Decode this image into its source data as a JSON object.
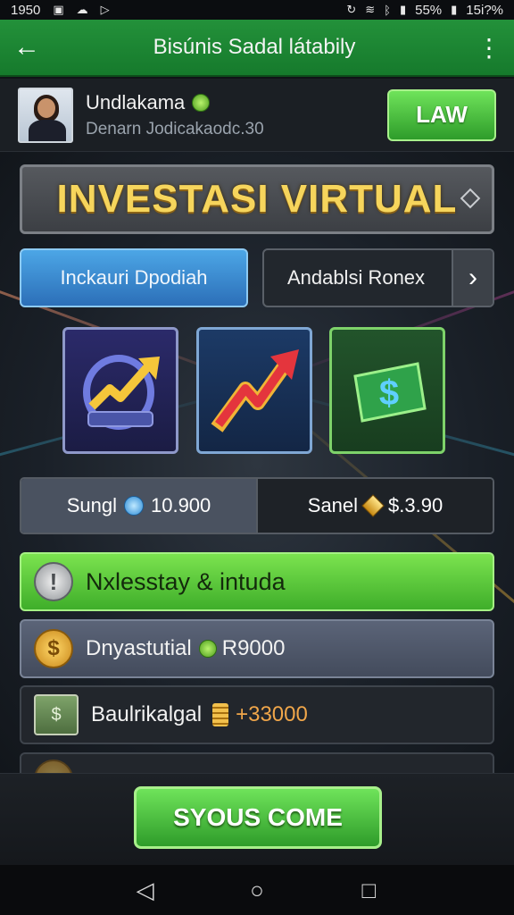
{
  "status_bar": {
    "time": "1950",
    "battery": "55%",
    "extra": "15i?%"
  },
  "app_bar": {
    "title": "Bisúnis Sadal látabily"
  },
  "profile": {
    "name": "Undlakama",
    "subtitle": "Denarn Jodicakaodc.30",
    "action_label": "LAW"
  },
  "banner": {
    "title": "INVESTASI VIRTUAL"
  },
  "tabs": [
    {
      "label": "Inckauri Dpodiah"
    },
    {
      "label": "Andablsi Ronex"
    }
  ],
  "tiles": [
    {
      "icon": "rising-chart-icon"
    },
    {
      "icon": "trend-arrow-icon"
    },
    {
      "icon": "dollar-bill-icon"
    }
  ],
  "stats": {
    "left_label": "Sungl",
    "left_value": "10.900",
    "right_label": "Sanel",
    "right_value": "$.3.90"
  },
  "rows": [
    {
      "label": "Nxlesstay & intuda"
    },
    {
      "label": "Dnyastutial",
      "amount": "R9000"
    },
    {
      "label": "Baulrikalgal",
      "amount": "+33000"
    }
  ],
  "cta": {
    "label": "SYOUS COME"
  },
  "colors": {
    "brand_green": "#23913a",
    "accent_blue": "#3a8fd6",
    "gold_text": "#f6d55c"
  }
}
